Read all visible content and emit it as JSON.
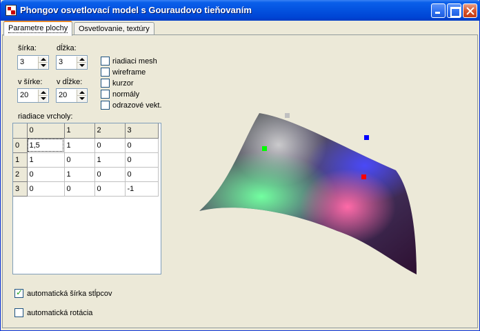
{
  "window": {
    "title": "Phongov osvetlovací model s Gouraudovo tieňovaním"
  },
  "tabs": [
    {
      "label": "Parametre plochy",
      "active": true
    },
    {
      "label": "Osvetlovanie, textúry",
      "active": false
    }
  ],
  "params": {
    "sirka_label": "šírka:",
    "sirka_value": "3",
    "dlzka_label": "dĺžka:",
    "dlzka_value": "3",
    "v_sirke_label": "v šírke:",
    "v_sirke_value": "20",
    "v_dlzke_label": "v dĺžke:",
    "v_dlzke_value": "20"
  },
  "options": [
    {
      "label": "riadiaci mesh",
      "checked": false
    },
    {
      "label": "wireframe",
      "checked": false
    },
    {
      "label": "kurzor",
      "checked": false
    },
    {
      "label": "normály",
      "checked": false
    },
    {
      "label": "odrazové vekt.",
      "checked": false
    }
  ],
  "grid": {
    "label": "riadiace vrcholy:",
    "columns": [
      "0",
      "1",
      "2",
      "3"
    ],
    "rows": [
      {
        "header": "0",
        "cells": [
          "1,5",
          "1",
          "0",
          "0"
        ]
      },
      {
        "header": "1",
        "cells": [
          "1",
          "0",
          "1",
          "0"
        ]
      },
      {
        "header": "2",
        "cells": [
          "0",
          "1",
          "0",
          "0"
        ]
      },
      {
        "header": "3",
        "cells": [
          "0",
          "0",
          "0",
          "-1"
        ]
      }
    ]
  },
  "bottom": {
    "auto_width_label": "automatická šírka stĺpcov",
    "auto_width_checked": true,
    "auto_rotation_label": "automatická rotácia",
    "auto_rotation_checked": false
  },
  "colors": {
    "light_green": "#00ff00",
    "light_blue": "#0000ff",
    "light_red": "#ff0000",
    "light_gray": "#c0c0c0"
  }
}
